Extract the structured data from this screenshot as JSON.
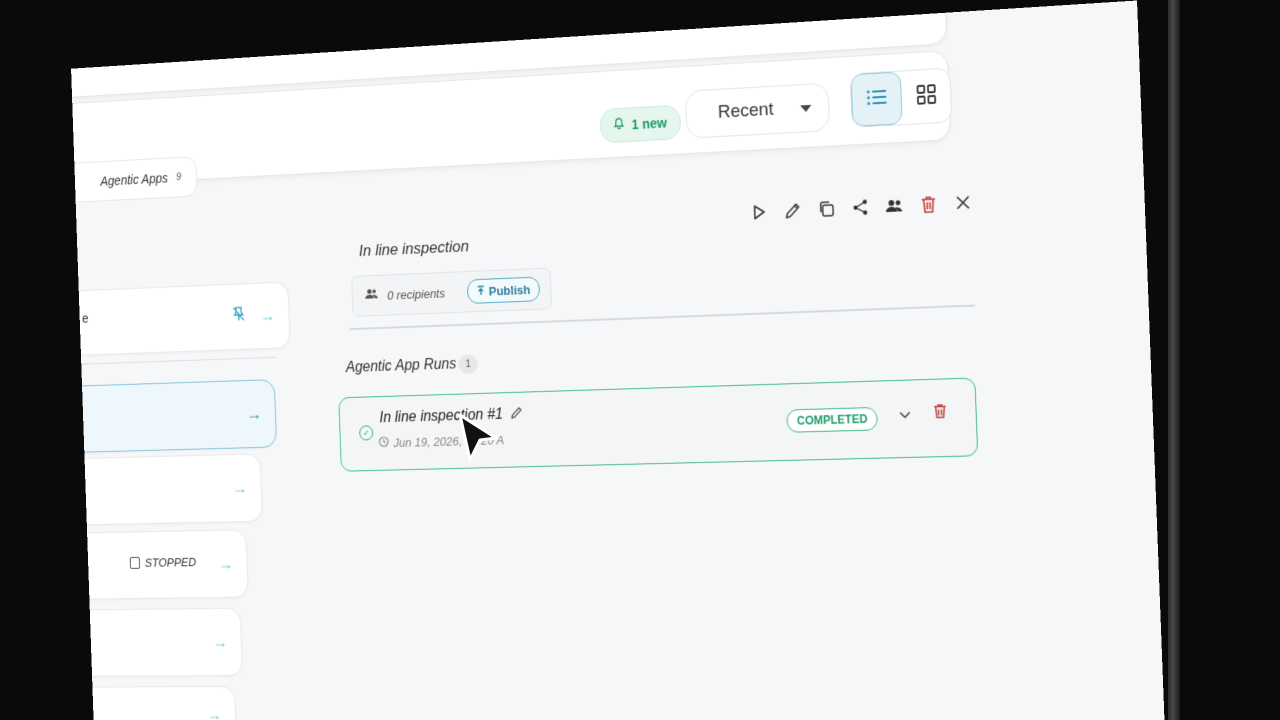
{
  "header": {
    "apps_chip": {
      "label": "Agentic Apps",
      "count": "9"
    },
    "new_pill": "1 new",
    "sort": {
      "selected": "Recent"
    },
    "view_toggle": {
      "active": "list"
    }
  },
  "left_list": {
    "items": [
      {
        "label_fragment": "e",
        "icon": "pin-off-icon"
      },
      {
        "label_fragment": ""
      },
      {
        "label_fragment": ""
      },
      {
        "status": "STOPPED"
      },
      {
        "label_fragment": ""
      },
      {
        "label_fragment": ""
      }
    ]
  },
  "detail": {
    "title": "In line inspection",
    "actions": [
      "play-icon",
      "edit-icon",
      "copy-icon",
      "share-icon",
      "users-icon",
      "trash-icon",
      "close-icon"
    ],
    "recipients": "0 recipients",
    "publish_label": "Publish",
    "runs": {
      "title": "Agentic App Runs",
      "count": "1",
      "items": [
        {
          "name": "In line inspection #1",
          "time": "Jun 19, 2026, 10:20 A",
          "status": "COMPLETED"
        }
      ]
    }
  },
  "colors": {
    "accent_green": "#3cbc86",
    "accent_blue": "#4fa7c7",
    "danger": "#c43c3c"
  }
}
